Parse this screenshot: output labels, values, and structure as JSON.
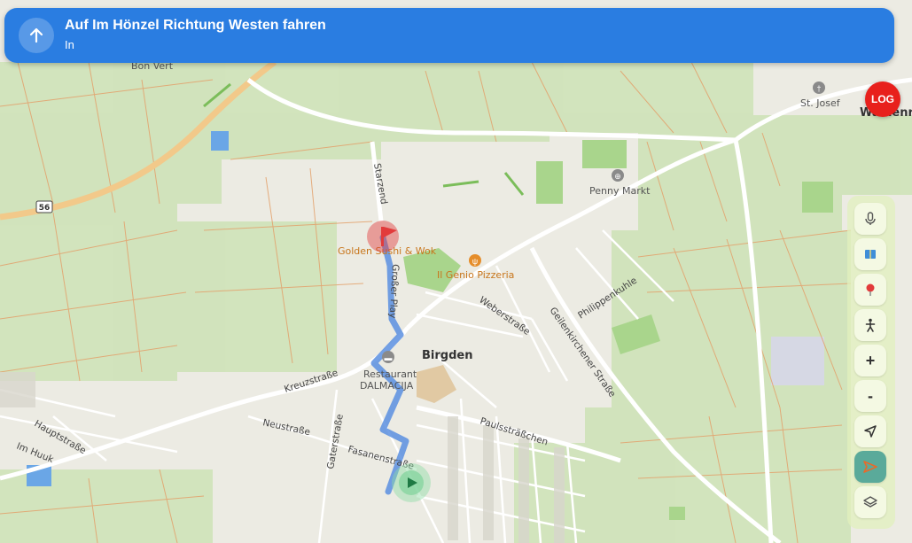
{
  "instruction": {
    "title": "Auf Im Hönzel Richtung Westen fahren",
    "subtitle": "In"
  },
  "log_badge": "LOG",
  "map": {
    "places": {
      "bon_vert": "Bon Vert",
      "st_josef": "St. Josef",
      "wehrener_partial": "Waldenra",
      "birgden": "Birgden",
      "penny": "Penny Markt",
      "golden_sushi": "Golden Sushi & Wok",
      "genio": "Il Genio Pizzeria",
      "restaurant_line1": "Restaurant",
      "restaurant_line2": "DALMACIJA",
      "route_shield": "56"
    },
    "streets": {
      "starzend": "Starzend",
      "grosser_play": "Großer Play",
      "weberstrasse": "Weberstraße",
      "philippenkuhle": "Philippenkuhle",
      "geilenkirchener": "Geilenkirchener Straße",
      "kreuzstrasse": "Kreuzstraße",
      "neustrasse": "Neustraße",
      "gaterstrasse": "Gaterstraße",
      "fasanenstrasse": "Fasanenstraße",
      "paulsstrasschen": "Paulssträßchen",
      "hauptstrasse": "Hauptstraße",
      "im_huuk": "Im Huuk"
    }
  },
  "controls": [
    {
      "name": "microphone-button",
      "icon": "microphone-icon"
    },
    {
      "name": "map-book-button",
      "icon": "map-book-icon"
    },
    {
      "name": "pin-button",
      "icon": "pin-icon"
    },
    {
      "name": "pedestrian-button",
      "icon": "pedestrian-icon"
    },
    {
      "name": "zoom-in-button",
      "icon": "plus-icon",
      "label": "+"
    },
    {
      "name": "zoom-out-button",
      "icon": "minus-icon",
      "label": "-"
    },
    {
      "name": "locate-button",
      "icon": "navigation-arrow-icon"
    },
    {
      "name": "navigate-button",
      "icon": "send-icon",
      "active": true
    },
    {
      "name": "layers-button",
      "icon": "layers-icon"
    }
  ],
  "colors": {
    "banner": "#2a7de1",
    "route": "#5b8fe0",
    "destination": "#e23b3b",
    "current_position": "#3bb56a",
    "log": "#e8201c"
  }
}
